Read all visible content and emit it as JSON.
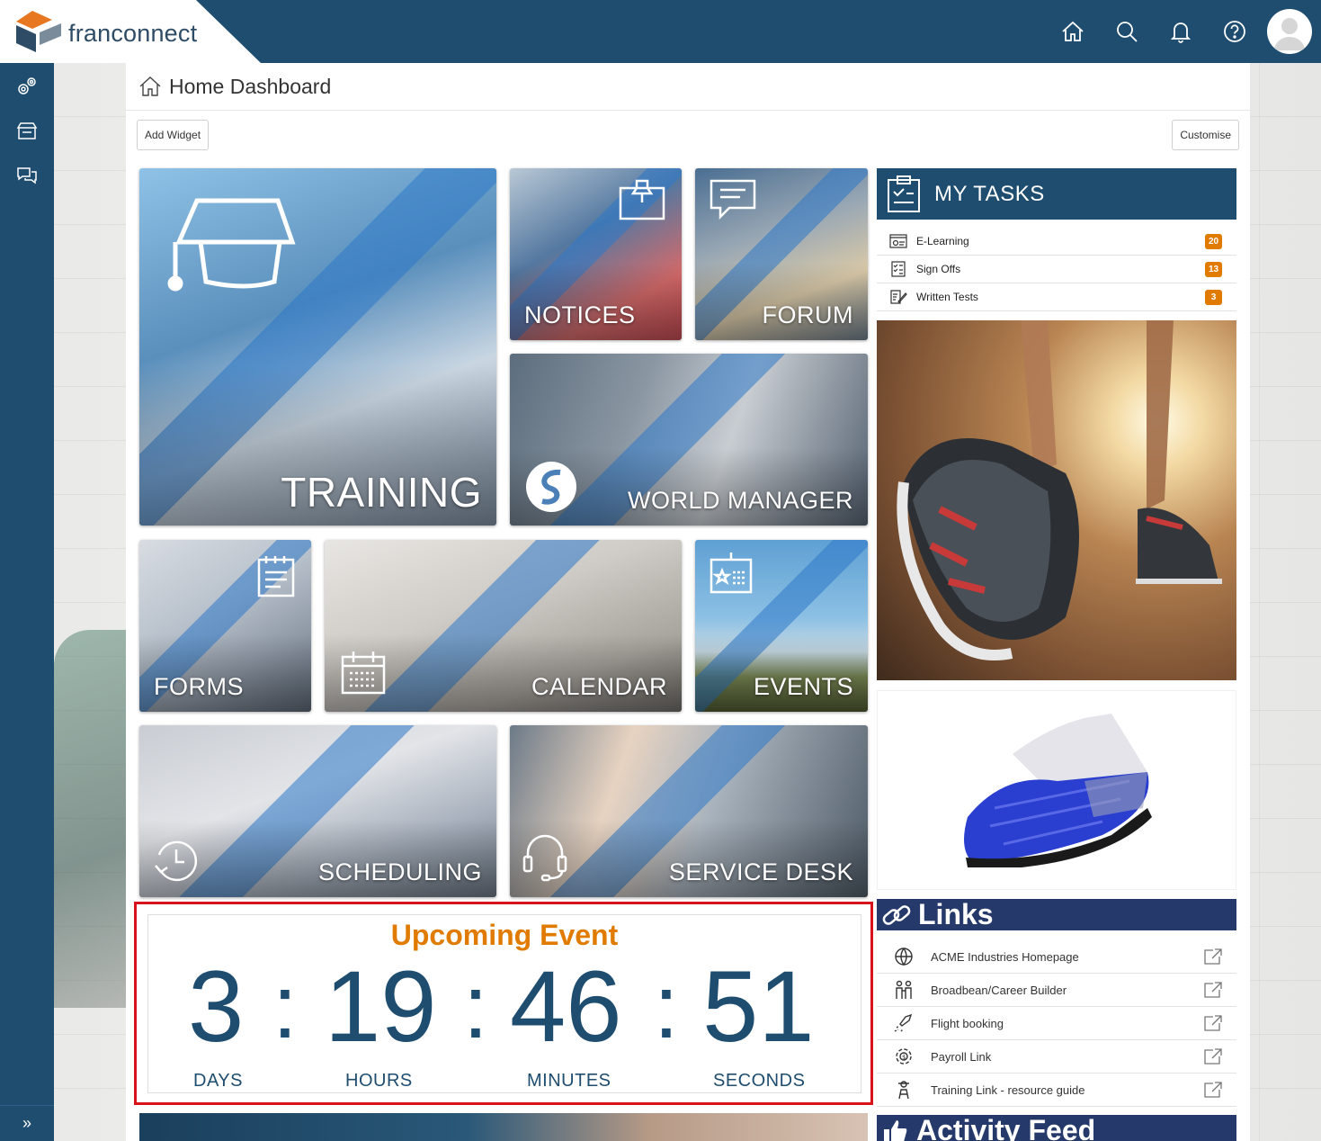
{
  "brand": {
    "name": "franconnect",
    "primary_color": "#1e4d6f",
    "accent_color": "#e07b00",
    "highlight_color": "#d8131c"
  },
  "topbar": {
    "icons": [
      "home-icon",
      "search-icon",
      "bell-icon",
      "help-icon",
      "avatar"
    ]
  },
  "sidebar": {
    "icons": [
      "gears-icon",
      "store-icon",
      "chat-icon"
    ],
    "expand_label": "»"
  },
  "page": {
    "title": "Home Dashboard"
  },
  "toolbar": {
    "add_widget_label": "Add Widget",
    "customise_label": "Customise"
  },
  "tiles": {
    "training": "TRAINING",
    "notices": "NOTICES",
    "forum": "FORUM",
    "world_manager": "WORLD MANAGER",
    "forms": "FORMS",
    "calendar": "CALENDAR",
    "events": "EVENTS",
    "scheduling": "SCHEDULING",
    "service_desk": "SERVICE DESK"
  },
  "tasks": {
    "title": "MY TASKS",
    "items": [
      {
        "label": "E-Learning",
        "count": "20"
      },
      {
        "label": "Sign Offs",
        "count": "13"
      },
      {
        "label": "Written Tests",
        "count": "3"
      }
    ]
  },
  "links": {
    "title": "Links",
    "items": [
      {
        "label": "ACME Industries Homepage",
        "icon": "globe-icon"
      },
      {
        "label": "Broadbean/Career Builder",
        "icon": "people-icon"
      },
      {
        "label": "Flight booking",
        "icon": "plane-icon"
      },
      {
        "label": "Payroll Link",
        "icon": "gear-icon"
      },
      {
        "label": "Training Link - resource guide",
        "icon": "trainer-icon"
      }
    ]
  },
  "activity": {
    "title": "Activity Feed"
  },
  "countdown": {
    "title": "Upcoming Event",
    "days": "3",
    "hours": "19",
    "minutes": "46",
    "seconds": "51",
    "separator": ":",
    "days_label": "DAYS",
    "hours_label": "HOURS",
    "minutes_label": "MINUTES",
    "seconds_label": "SECONDS"
  }
}
